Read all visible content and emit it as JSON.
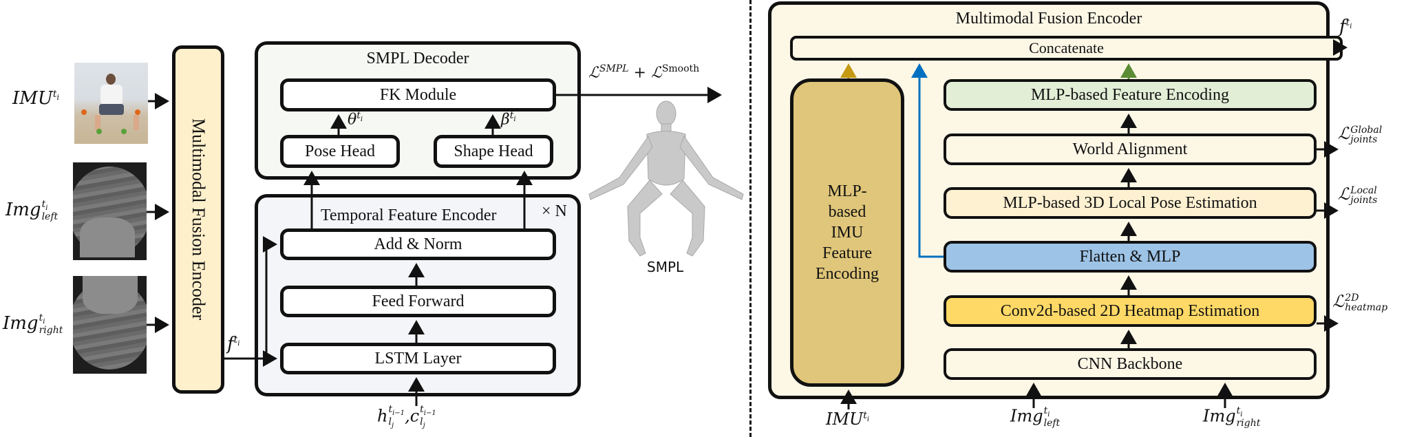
{
  "left_panel": {
    "inputs": [
      {
        "label_base": "IMU",
        "label_sup": "t",
        "label_sup_sub": "i",
        "label_sub": "",
        "image": "imu-person-photo"
      },
      {
        "label_base": "Img",
        "label_sup": "t",
        "label_sup_sub": "i",
        "label_sub": "left",
        "image": "left-fisheye-image"
      },
      {
        "label_base": "Img",
        "label_sup": "t",
        "label_sup_sub": "i",
        "label_sub": "right",
        "image": "right-fisheye-image"
      }
    ],
    "fusion_encoder_label": "Multimodal Fusion Encoder",
    "feature_label": "f",
    "feature_sup": "t",
    "feature_sup_sub": "i",
    "smpl_decoder": {
      "title": "SMPL Decoder",
      "fk_module": "FK Module",
      "pose_head": "Pose Head",
      "shape_head": "Shape Head",
      "theta_label": "θ",
      "beta_label": "β",
      "param_sup": "t",
      "param_sup_sub": "i"
    },
    "temporal_encoder": {
      "title": "Temporal Feature Encoder",
      "repeat_label": "× N",
      "add_norm": "Add & Norm",
      "feed_forward": "Feed Forward",
      "lstm_layer": "LSTM Layer",
      "hidden_input_label": "h",
      "cell_input_label": "c",
      "hidden_sup": "t",
      "hidden_sup_sub": "i−1",
      "hidden_sub": "l",
      "hidden_sub_sub": "j"
    },
    "loss_label": "ℒ",
    "loss_sup_1": "SMPL",
    "loss_plus": "+",
    "loss_sup_2": "Smooth",
    "smpl_caption": "SMPL"
  },
  "right_panel": {
    "title": "Multimodal Fusion Encoder",
    "concatenate": "Concatenate",
    "imu_encoding": [
      "MLP-",
      "based",
      "IMU",
      "Feature",
      "Encoding"
    ],
    "mlp_feature_encoding": "MLP-based Feature Encoding",
    "world_alignment": "World Alignment",
    "local_pose_estimation": "MLP-based 3D Local Pose Estimation",
    "flatten_mlp": "Flatten & MLP",
    "heatmap_estimation": "Conv2d-based 2D Heatmap Estimation",
    "cnn_backbone": "CNN Backbone",
    "output_label": "f",
    "output_sup": "t",
    "output_sup_sub": "i",
    "loss_global": {
      "base": "ℒ",
      "sup": "Global",
      "sub": "joints"
    },
    "loss_local": {
      "base": "ℒ",
      "sup": "Local",
      "sub": "joints"
    },
    "loss_heatmap": {
      "base": "ℒ",
      "sup": "2D",
      "sub": "heatmap"
    },
    "bottom_inputs": [
      {
        "base": "IMU",
        "sup": "t",
        "sup_sub": "i",
        "sub": ""
      },
      {
        "base": "Img",
        "sup": "t",
        "sup_sub": "i",
        "sub": "left"
      },
      {
        "base": "Img",
        "sup": "t",
        "sup_sub": "i",
        "sub": "right"
      }
    ]
  },
  "colors": {
    "fusion_encoder_fill": "#FFF0CC",
    "smpl_decoder_fill": "#F6F8F4",
    "temporal_encoder_fill": "#F3F5F8",
    "right_panel_fill": "#FDF7E6",
    "imu_encoding_fill": "#E0C67A",
    "mlp_feature_fill": "#E2EED6",
    "local_pose_fill": "#FEF1D2",
    "flatten_fill": "#9DC3E6",
    "heatmap_fill": "#FFD966",
    "arrow_gold": "#C49A13",
    "arrow_blue": "#0070C0",
    "arrow_green": "#5B8C35"
  }
}
